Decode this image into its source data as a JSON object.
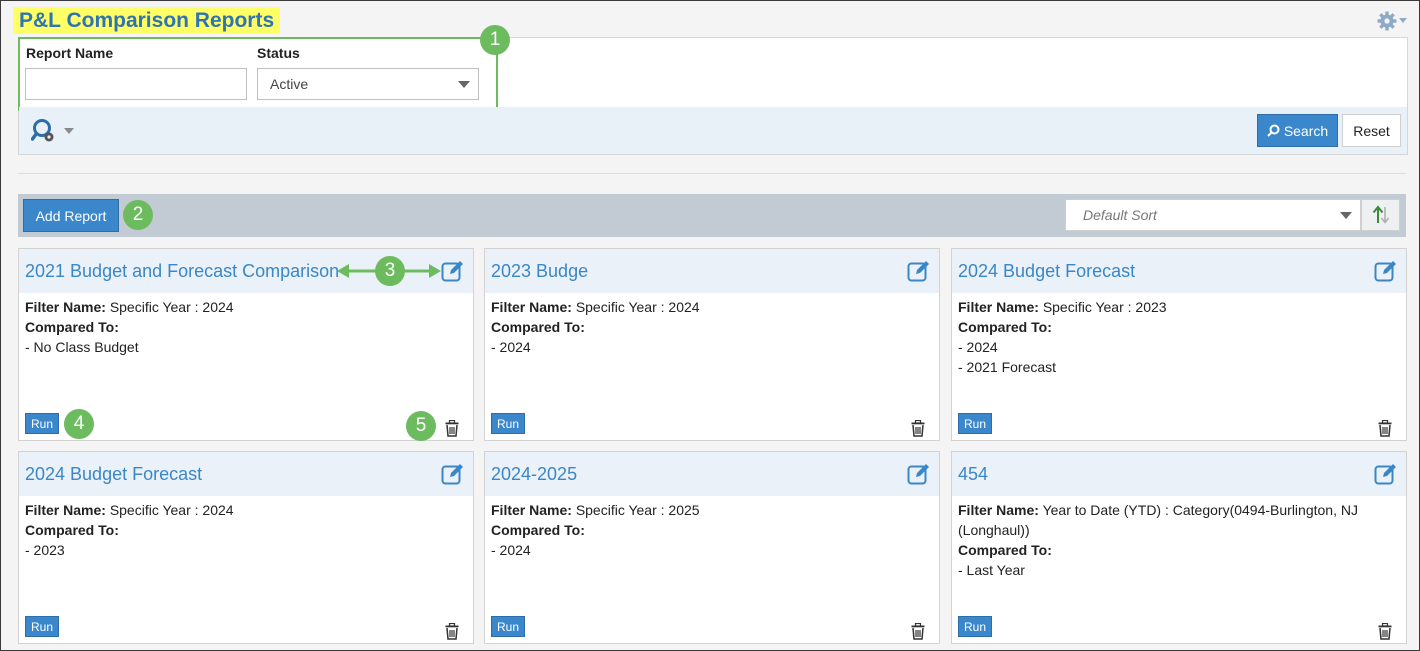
{
  "page": {
    "title": "P&L Comparison Reports"
  },
  "filters": {
    "report_name_label": "Report Name",
    "report_name_value": "",
    "status_label": "Status",
    "status_value": "Active",
    "search_label": "Search",
    "reset_label": "Reset"
  },
  "toolbar": {
    "add_report_label": "Add Report",
    "sort_value": "Default Sort"
  },
  "labels": {
    "filter_name": "Filter Name:",
    "compared_to": "Compared To:",
    "run": "Run"
  },
  "reports": [
    {
      "title": "2021 Budget and Forecast Comparison",
      "filter_name": "Specific Year : 2024",
      "compared": [
        "- No Class Budget"
      ]
    },
    {
      "title": "2023 Budge",
      "filter_name": "Specific Year : 2024",
      "compared": [
        "- 2024"
      ]
    },
    {
      "title": "2024 Budget Forecast",
      "filter_name": "Specific Year : 2023",
      "compared": [
        "- 2024",
        "- 2021 Forecast"
      ]
    },
    {
      "title": "2024 Budget Forecast",
      "filter_name": "Specific Year : 2024",
      "compared": [
        "- 2023"
      ]
    },
    {
      "title": "2024-2025",
      "filter_name": "Specific Year : 2025",
      "compared": [
        "- 2024"
      ]
    },
    {
      "title": "454",
      "filter_name": "Year to Date (YTD) : Category(0494-Burlington, NJ (Longhaul))",
      "compared": [
        "- Last Year"
      ]
    }
  ],
  "callouts": [
    "1",
    "2",
    "3",
    "4",
    "5"
  ],
  "colors": {
    "accent": "#3b87cc",
    "callout": "#6dbb5f",
    "title_highlight": "#ffff66"
  },
  "icons": [
    "gear-icon",
    "search-settings-icon",
    "magnifier-icon",
    "sort-direction-icon",
    "edit-icon",
    "trash-icon",
    "chevron-down-icon"
  ]
}
